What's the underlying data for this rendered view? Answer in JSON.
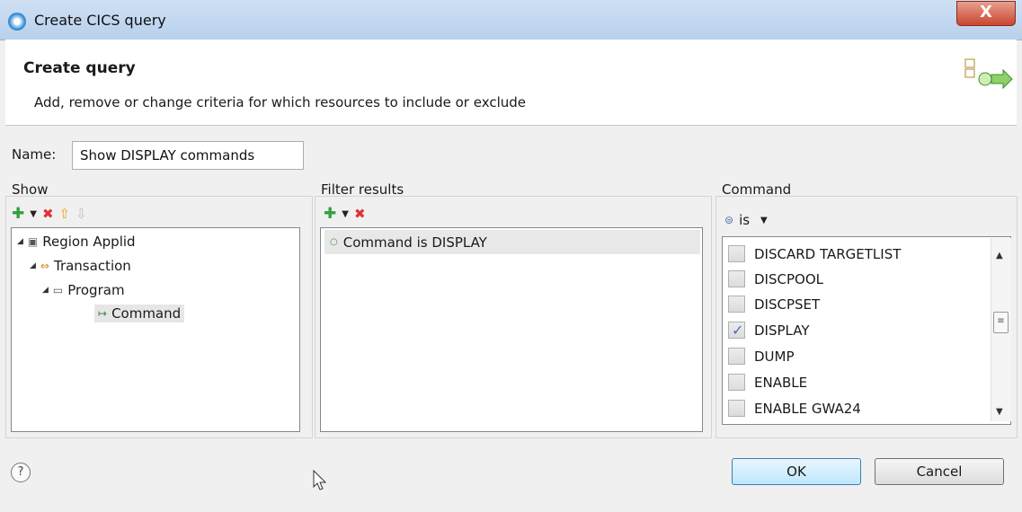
{
  "window": {
    "title": "Create CICS query",
    "close_label": "X"
  },
  "header": {
    "title": "Create query",
    "description": "Add, remove or change criteria for which resources to include or exclude",
    "icon": "query-wizard-icon"
  },
  "name_field": {
    "label": "Name:",
    "value": "Show DISPLAY commands"
  },
  "show_section": {
    "label": "Show",
    "tree": [
      {
        "label": "Region Applid",
        "icon": "region-icon"
      },
      {
        "label": "Transaction",
        "icon": "transaction-icon"
      },
      {
        "label": "Program",
        "icon": "program-icon"
      },
      {
        "label": "Command",
        "icon": "command-icon"
      }
    ]
  },
  "filter_section": {
    "label": "Filter results",
    "items": [
      {
        "label": "Command is DISPLAY"
      }
    ]
  },
  "command_section": {
    "label": "Command",
    "operator": "is",
    "options": [
      {
        "label": "DISCARD TARGETLIST",
        "checked": false
      },
      {
        "label": "DISCPOOL",
        "checked": false
      },
      {
        "label": "DISCPSET",
        "checked": false
      },
      {
        "label": "DISPLAY",
        "checked": true
      },
      {
        "label": "DUMP",
        "checked": false
      },
      {
        "label": "ENABLE",
        "checked": false
      },
      {
        "label": "ENABLE GWA24",
        "checked": false
      }
    ]
  },
  "footer": {
    "ok_label": "OK",
    "cancel_label": "Cancel"
  }
}
